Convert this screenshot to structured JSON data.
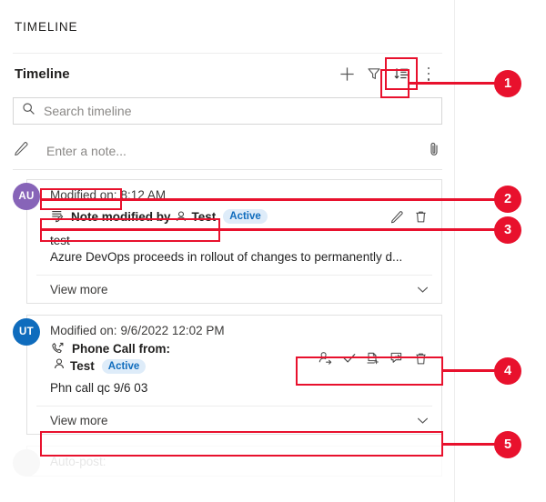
{
  "header": {
    "title": "TIMELINE"
  },
  "toolbar": {
    "title": "Timeline",
    "add_label": "+",
    "icons": [
      "add-icon",
      "filter-icon",
      "sort-icon",
      "more-options-icon"
    ]
  },
  "search": {
    "placeholder": "Search timeline",
    "icon": "search-icon"
  },
  "note_entry": {
    "placeholder": "Enter a note...",
    "icon": "pencil-icon",
    "attach_icon": "paperclip-icon"
  },
  "items": [
    {
      "avatar": {
        "initials": "AU",
        "color": "#8764b8"
      },
      "modified_label": "Modified on:",
      "modified_value": "8:12 AM",
      "title": "Note modified by",
      "title_icon": "note-icon",
      "person_icon": "person-icon",
      "person": "Test",
      "status": "Active",
      "actions": [
        "edit-icon",
        "delete-icon"
      ],
      "body": [
        "test",
        "Azure DevOps proceeds in rollout of changes to permanently d..."
      ],
      "view_more": "View more",
      "chevron": "chevron-down-icon"
    },
    {
      "avatar": {
        "initials": "UT",
        "color": "#0f6cbd"
      },
      "modified_label": "Modified on:",
      "modified_value": "9/6/2022 12:02 PM",
      "title": "Phone Call from:",
      "title_icon": "phone-call-icon",
      "person_icon": "person-icon",
      "person": "Test",
      "status": "Active",
      "actions": [
        "assign-icon",
        "check-icon",
        "add-to-queue-icon",
        "convert-note-icon",
        "delete-icon"
      ],
      "body": [
        "Phn call qc 9/6 03"
      ],
      "view_more": "View more",
      "chevron": "chevron-down-icon"
    },
    {
      "avatar": {
        "initials": "",
        "color": "#c8c8c8"
      },
      "modified_label": "Auto-post:",
      "modified_value": "",
      "title": "",
      "title_icon": "",
      "person_icon": "",
      "person": "",
      "status": "",
      "actions": [],
      "body": [
        ""
      ],
      "view_more": "",
      "chevron": ""
    }
  ],
  "annotations": {
    "accent": "#e8112d",
    "callouts": [
      {
        "number": "1",
        "target": "sort-toolbar-button"
      },
      {
        "number": "2",
        "target": "modified-on-label"
      },
      {
        "number": "3",
        "target": "note-record-title"
      },
      {
        "number": "4",
        "target": "phone-call-action-icons"
      },
      {
        "number": "5",
        "target": "phone-call-view-more"
      }
    ]
  }
}
